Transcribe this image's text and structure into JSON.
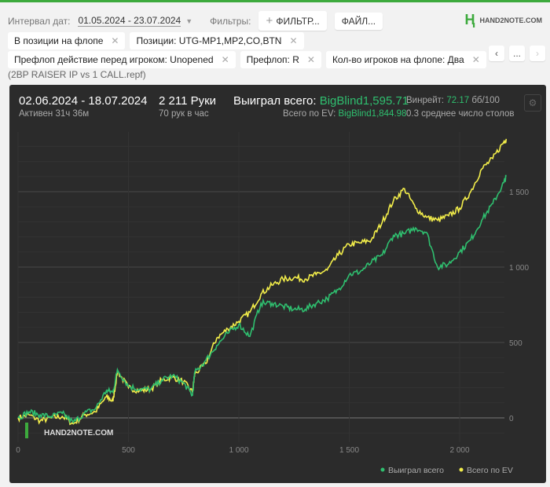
{
  "filters_bar": {
    "date_label": "Интервал дат:",
    "date_value": "01.05.2024 - 23.07.2024",
    "filters_label": "Фильтры:",
    "add_filter": "ФИЛЬТР...",
    "file": "ФАЙЛ...",
    "logo": "HAND2NOTE.COM"
  },
  "chips_row1": [
    "В позиции на флопе",
    "Позиции: UTG-MP1,MP2,CO,BTN"
  ],
  "chips_row2": [
    "Префлоп действие перед игроком: Unopened",
    "Префлоп: R",
    "Кол-во игроков на флопе: Два"
  ],
  "nav": {
    "prev": "‹",
    "more": "...",
    "next": "›"
  },
  "file_name": "(2BP RAISER IP vs 1 CALL.repf)",
  "summary": {
    "period": "02.06.2024 - 18.07.2024",
    "active": "Активен 31ч 36м",
    "hands": "2 211 Руки",
    "hands_per_hour": "70 рук в час",
    "won_label": "Выиграл всего:",
    "won_value": "BigBlind1,595.71",
    "ev_label": "Всего по EV:",
    "ev_value": "BigBlind1,844.98",
    "winrate_label": "Винрейт:",
    "winrate_value": "72.17",
    "winrate_unit": "бб/100",
    "tables": "0.3 среднее число столов"
  },
  "chart_data": {
    "type": "line",
    "xlim": [
      0,
      2211
    ],
    "ylim": [
      -150,
      1850
    ],
    "x_ticks": [
      "0",
      "500",
      "1 000",
      "1 500",
      "2 000"
    ],
    "y_ticks": [
      "0",
      "500",
      "1 000",
      "1 500"
    ],
    "watermark": "HAND2NOTE.COM",
    "legend_position": "bottom-right",
    "x": [
      0,
      50,
      100,
      150,
      200,
      250,
      300,
      350,
      400,
      430,
      450,
      500,
      550,
      600,
      650,
      700,
      750,
      790,
      800,
      850,
      900,
      950,
      1000,
      1050,
      1100,
      1150,
      1200,
      1250,
      1300,
      1350,
      1400,
      1450,
      1500,
      1550,
      1600,
      1650,
      1700,
      1750,
      1800,
      1850,
      1900,
      1950,
      2000,
      2050,
      2100,
      2150,
      2200,
      2211
    ],
    "series": [
      {
        "name": "Выиграл всего",
        "color": "#2fbf6f",
        "values": [
          0,
          40,
          20,
          10,
          30,
          -30,
          30,
          60,
          180,
          170,
          320,
          210,
          190,
          190,
          250,
          280,
          230,
          150,
          300,
          380,
          480,
          560,
          620,
          540,
          760,
          760,
          740,
          720,
          720,
          760,
          790,
          850,
          950,
          970,
          1030,
          1080,
          1210,
          1220,
          1260,
          1230,
          1000,
          1020,
          1100,
          1180,
          1310,
          1420,
          1560,
          1600
        ]
      },
      {
        "name": "Всего по EV",
        "color": "#f3ee4a",
        "values": [
          0,
          20,
          -20,
          0,
          10,
          -40,
          20,
          40,
          140,
          110,
          310,
          200,
          180,
          190,
          250,
          270,
          240,
          170,
          290,
          360,
          530,
          590,
          640,
          700,
          820,
          880,
          920,
          930,
          920,
          950,
          980,
          1080,
          1150,
          1160,
          1180,
          1300,
          1440,
          1520,
          1390,
          1330,
          1310,
          1340,
          1390,
          1500,
          1650,
          1720,
          1830,
          1850
        ]
      }
    ]
  }
}
